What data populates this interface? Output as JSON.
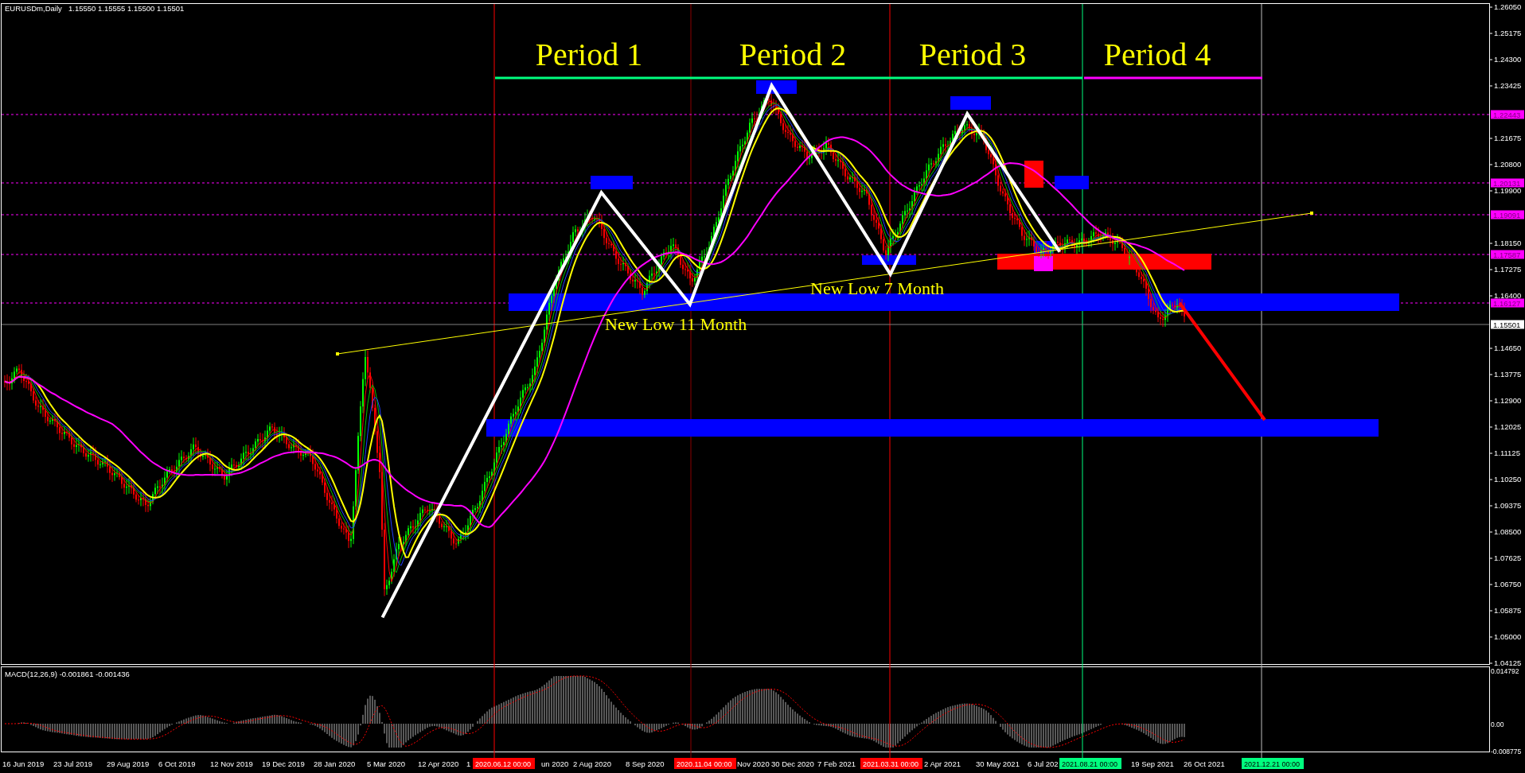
{
  "header": {
    "symbol": "EURUSDm,Daily",
    "quotes": "1.15550 1.15555 1.15500 1.15501"
  },
  "periods": [
    "Period 1",
    "Period 2",
    "Period 3",
    "Period 4"
  ],
  "annotations": [
    "New Low 11 Month",
    "New Low 7 Month"
  ],
  "price_axis": {
    "ticks": [
      "1.26050",
      "1.25175",
      "1.24300",
      "1.23425",
      "1.21675",
      "1.20800",
      "1.19900",
      "1.18150",
      "1.17275",
      "1.16400",
      "1.14650",
      "1.13775",
      "1.12900",
      "1.12025",
      "1.11125",
      "1.10250",
      "1.09375",
      "1.08500",
      "1.07625",
      "1.06750",
      "1.05875",
      "1.05000",
      "1.04125"
    ],
    "levels": [
      {
        "label": "1.22443",
        "color": "#ff00ff"
      },
      {
        "label": "1.20131",
        "color": "#ff00ff"
      },
      {
        "label": "1.19091",
        "color": "#ff00ff"
      },
      {
        "label": "1.17587",
        "color": "#ff00ff"
      },
      {
        "label": "1.16127",
        "color": "#ff00ff"
      },
      {
        "label": "1.15501",
        "color": "#ffffff"
      }
    ]
  },
  "macd": {
    "label": "MACD(12,26,9) -0.001861 -0.001436",
    "axis": [
      "0.014792",
      "0.00",
      "-0.008775"
    ]
  },
  "time_axis": [
    {
      "label": "16 Jun 2019",
      "kind": "date"
    },
    {
      "label": "23 Jul 2019",
      "kind": "date"
    },
    {
      "label": "29 Aug 2019",
      "kind": "date"
    },
    {
      "label": "6 Oct 2019",
      "kind": "date"
    },
    {
      "label": "12 Nov 2019",
      "kind": "date"
    },
    {
      "label": "19 Dec 2019",
      "kind": "date"
    },
    {
      "label": "28 Jan 2020",
      "kind": "date"
    },
    {
      "label": "5 Mar 2020",
      "kind": "date"
    },
    {
      "label": "12 Apr 2020",
      "kind": "date"
    },
    {
      "label": "1",
      "kind": "date"
    },
    {
      "label": "2020.06.12 00:00",
      "kind": "marker",
      "color": "#ff0000"
    },
    {
      "label": "un 2020",
      "kind": "date"
    },
    {
      "label": "2 Aug 2020",
      "kind": "date"
    },
    {
      "label": "8 Sep 2020",
      "kind": "date"
    },
    {
      "label": "2020.11.04 00:00",
      "kind": "marker",
      "color": "#ff0000"
    },
    {
      "label": "Nov 2020",
      "kind": "date"
    },
    {
      "label": "30 Dec 2020",
      "kind": "date"
    },
    {
      "label": "7 Feb 2021",
      "kind": "date"
    },
    {
      "label": "2021.03.31 00:00",
      "kind": "marker",
      "color": "#ff0000"
    },
    {
      "label": "2 Apr 2021",
      "kind": "date"
    },
    {
      "label": "30 May 2021",
      "kind": "date"
    },
    {
      "label": "6 Jul 202",
      "kind": "date"
    },
    {
      "label": "2021.08.21 00:00",
      "kind": "marker",
      "color": "#00ff7f"
    },
    {
      "label": "19 Sep 2021",
      "kind": "date"
    },
    {
      "label": "26 Oct 2021",
      "kind": "date"
    },
    {
      "label": "2021.12.21 00:00",
      "kind": "marker",
      "color": "#00ff7f"
    }
  ]
}
